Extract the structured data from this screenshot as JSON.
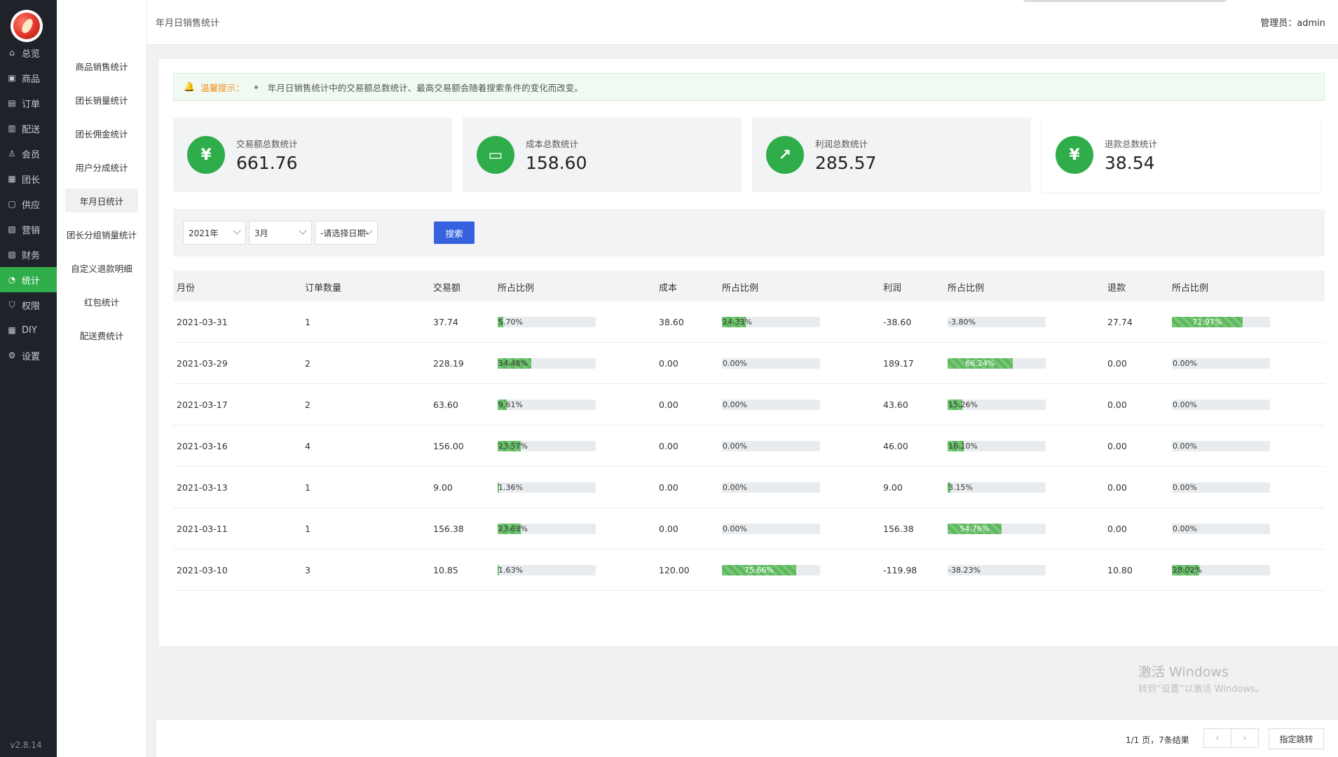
{
  "nav": {
    "items": [
      {
        "label": "总览",
        "icon": "home-icon",
        "glyph": "⌂"
      },
      {
        "label": "商品",
        "icon": "goods-icon",
        "glyph": "▣"
      },
      {
        "label": "订单",
        "icon": "order-icon",
        "glyph": "▤"
      },
      {
        "label": "配送",
        "icon": "delivery-icon",
        "glyph": "▥"
      },
      {
        "label": "会员",
        "icon": "user-icon",
        "glyph": "♙"
      },
      {
        "label": "团长",
        "icon": "leader-icon",
        "glyph": "▦"
      },
      {
        "label": "供应",
        "icon": "supply-icon",
        "glyph": "▢"
      },
      {
        "label": "营销",
        "icon": "gift-icon",
        "glyph": "▧"
      },
      {
        "label": "财务",
        "icon": "finance-icon",
        "glyph": "▨"
      },
      {
        "label": "统计",
        "icon": "chart-pie-icon",
        "glyph": "◔"
      },
      {
        "label": "权限",
        "icon": "shield-icon",
        "glyph": "⛉"
      },
      {
        "label": "DIY",
        "icon": "layout-icon",
        "glyph": "▦"
      },
      {
        "label": "设置",
        "icon": "gear-icon",
        "glyph": "⚙"
      }
    ],
    "active_index": 9,
    "version": "v2.8.14"
  },
  "submenu": {
    "items": [
      "商品销售统计",
      "团长销量统计",
      "团长佣金统计",
      "用户分成统计",
      "年月日统计",
      "团长分组销量统计",
      "自定义退款明细",
      "红包统计",
      "配送费统计"
    ],
    "active_index": 4
  },
  "header": {
    "title": "年月日销售统计",
    "admin_label": "管理员：",
    "admin_name": "admin"
  },
  "tip": {
    "label": "温馨提示：",
    "text": "年月日销售统计中的交易额总数统计、最高交易额会随着搜索条件的变化而改变。"
  },
  "stats": [
    {
      "label": "交易额总数统计",
      "value": "661.76",
      "icon": "yen-shield-icon",
      "glyph": "¥"
    },
    {
      "label": "成本总数统计",
      "value": "158.60",
      "icon": "archive-box-icon",
      "glyph": "▭"
    },
    {
      "label": "利润总数统计",
      "value": "285.57",
      "icon": "growth-chart-icon",
      "glyph": "↗"
    },
    {
      "label": "退款总数统计",
      "value": "38.54",
      "icon": "refund-yen-icon",
      "glyph": "¥"
    }
  ],
  "filter": {
    "year": "2021年",
    "month": "3月",
    "day_placeholder": "-请选择日期-",
    "search_label": "搜索"
  },
  "table": {
    "headers": [
      "月份",
      "订单数量",
      "交易额",
      "所占比例",
      "成本",
      "所占比例",
      "利润",
      "所占比例",
      "退款",
      "所占比例"
    ],
    "rows": [
      {
        "date": "2021-03-31",
        "orders": "1",
        "amount": "37.74",
        "amount_pct": "5.70%",
        "amount_frac": 0.057,
        "cost": "38.60",
        "cost_pct": "24.33%",
        "cost_frac": 0.2433,
        "profit": "-38.60",
        "profit_pct": "-3.80%",
        "profit_frac": 0,
        "refund": "27.74",
        "refund_pct": "71.97%",
        "refund_frac": 0.7197
      },
      {
        "date": "2021-03-29",
        "orders": "2",
        "amount": "228.19",
        "amount_pct": "34.48%",
        "amount_frac": 0.3448,
        "cost": "0.00",
        "cost_pct": "0.00%",
        "cost_frac": 0,
        "profit": "189.17",
        "profit_pct": "66.24%",
        "profit_frac": 0.6624,
        "refund": "0.00",
        "refund_pct": "0.00%",
        "refund_frac": 0
      },
      {
        "date": "2021-03-17",
        "orders": "2",
        "amount": "63.60",
        "amount_pct": "9.61%",
        "amount_frac": 0.0961,
        "cost": "0.00",
        "cost_pct": "0.00%",
        "cost_frac": 0,
        "profit": "43.60",
        "profit_pct": "15.26%",
        "profit_frac": 0.1526,
        "refund": "0.00",
        "refund_pct": "0.00%",
        "refund_frac": 0
      },
      {
        "date": "2021-03-16",
        "orders": "4",
        "amount": "156.00",
        "amount_pct": "23.57%",
        "amount_frac": 0.2357,
        "cost": "0.00",
        "cost_pct": "0.00%",
        "cost_frac": 0,
        "profit": "46.00",
        "profit_pct": "16.10%",
        "profit_frac": 0.161,
        "refund": "0.00",
        "refund_pct": "0.00%",
        "refund_frac": 0
      },
      {
        "date": "2021-03-13",
        "orders": "1",
        "amount": "9.00",
        "amount_pct": "1.36%",
        "amount_frac": 0.0136,
        "cost": "0.00",
        "cost_pct": "0.00%",
        "cost_frac": 0,
        "profit": "9.00",
        "profit_pct": "3.15%",
        "profit_frac": 0.0315,
        "refund": "0.00",
        "refund_pct": "0.00%",
        "refund_frac": 0
      },
      {
        "date": "2021-03-11",
        "orders": "1",
        "amount": "156.38",
        "amount_pct": "23.63%",
        "amount_frac": 0.2363,
        "cost": "0.00",
        "cost_pct": "0.00%",
        "cost_frac": 0,
        "profit": "156.38",
        "profit_pct": "54.76%",
        "profit_frac": 0.5476,
        "refund": "0.00",
        "refund_pct": "0.00%",
        "refund_frac": 0
      },
      {
        "date": "2021-03-10",
        "orders": "3",
        "amount": "10.85",
        "amount_pct": "1.63%",
        "amount_frac": 0.0163,
        "cost": "120.00",
        "cost_pct": "75.66%",
        "cost_frac": 0.7566,
        "profit": "-119.98",
        "profit_pct": "-38.23%",
        "profit_frac": 0,
        "refund": "10.80",
        "refund_pct": "28.02%",
        "refund_frac": 0.2802
      }
    ]
  },
  "watermark": {
    "line1": "激活 Windows",
    "line2": "转到“设置”以激活 Windows。"
  },
  "pagination": {
    "info": "1/1 页，7条结果",
    "prev": "‹",
    "next": "›",
    "jump_label": "指定跳转"
  },
  "colors": {
    "accent_green": "#2fad4a",
    "nav_bg": "#20222a",
    "search_blue": "#3662e0",
    "warning_orange": "#f58a16"
  }
}
